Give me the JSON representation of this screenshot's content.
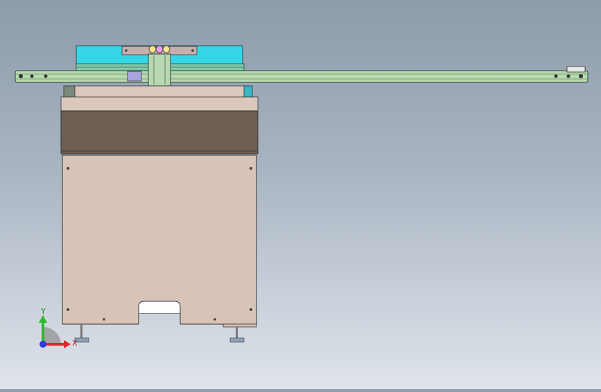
{
  "viewport": {
    "background_top": "#8d9bab",
    "background_bottom": "#dfe4ea"
  },
  "triad": {
    "y_label": "Y",
    "x_label": "X",
    "y_color": "#2db82d",
    "x_color": "#e0262b",
    "z_color": "#2b3fd6"
  },
  "model_colors": {
    "cyan_tray": "#36d6e6",
    "rail": "#b6d9b0",
    "cabinet_panel": "#d8c3b9",
    "dark_band": "#6f5e52",
    "top_plate": "#dcc7bd"
  }
}
